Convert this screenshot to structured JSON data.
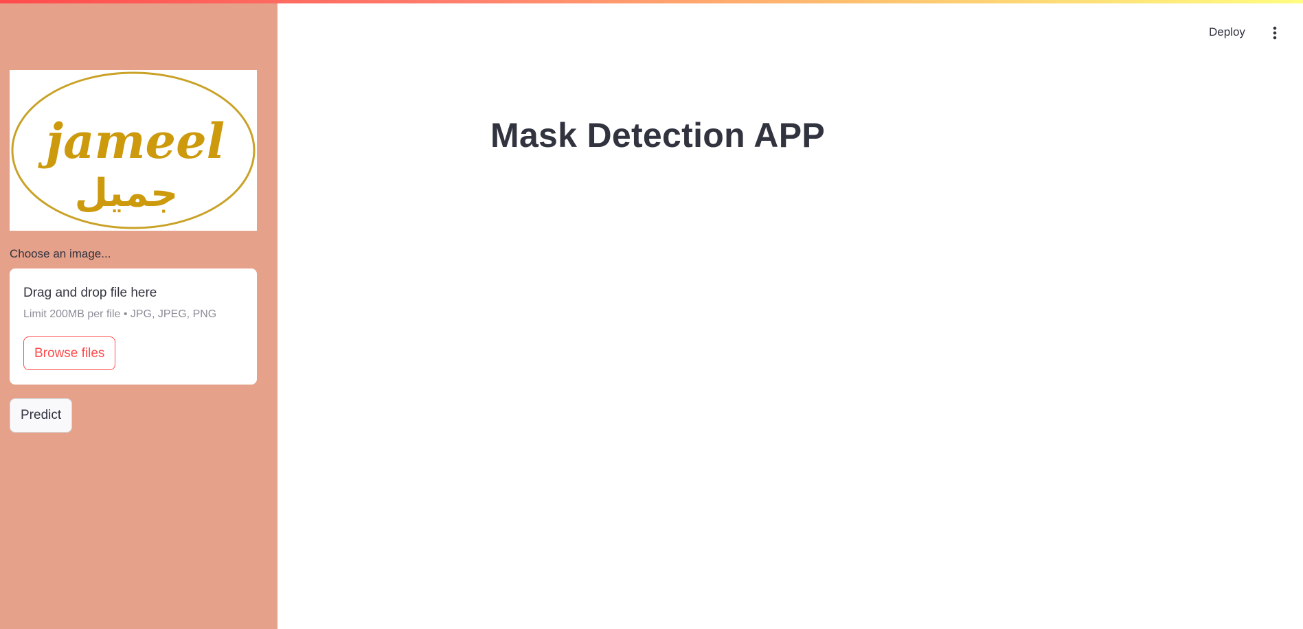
{
  "header": {
    "deploy_label": "Deploy",
    "menu_icon": "kebab-menu-icon"
  },
  "sidebar": {
    "logo": {
      "alt": "jameel logo",
      "text_latin": "jameel",
      "text_arabic": "جميل",
      "color": "#cc9a0c"
    },
    "file_uploader": {
      "label": "Choose an image...",
      "drop_title": "Drag and drop file here",
      "limit_text": "Limit 200MB per file • JPG, JPEG, PNG",
      "browse_label": "Browse files"
    },
    "predict_label": "Predict"
  },
  "main": {
    "title": "Mask Detection APP"
  },
  "colors": {
    "sidebar_bg": "#e6a18a",
    "accent": "#ff4b4b",
    "text": "#31333f",
    "logo_gold": "#cc9a0c"
  }
}
